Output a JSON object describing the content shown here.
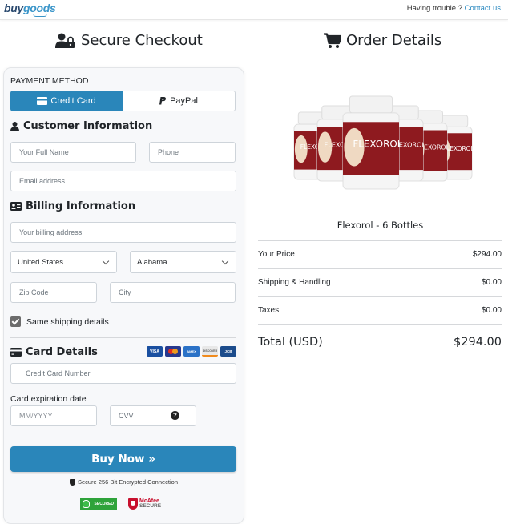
{
  "header": {
    "logo_part1": "buy",
    "logo_part2": "goods",
    "trouble_text": "Having trouble ? ",
    "contact_link": "Contact us"
  },
  "checkout": {
    "title": "Secure Checkout",
    "payment_method_label": "PAYMENT METHOD",
    "payment_methods": [
      {
        "label": "Credit Card",
        "selected": true
      },
      {
        "label": "PayPal",
        "selected": false
      }
    ],
    "customer_info": {
      "heading": "Customer Information",
      "full_name_placeholder": "Your Full Name",
      "phone_placeholder": "Phone",
      "email_placeholder": "Email address"
    },
    "billing_info": {
      "heading": "Billing Information",
      "address_placeholder": "Your billing address",
      "country_selected": "United States",
      "state_selected": "Alabama",
      "zip_placeholder": "Zip Code",
      "city_placeholder": "City",
      "same_shipping_label": "Same shipping details",
      "same_shipping_checked": true
    },
    "card_details": {
      "heading": "Card Details",
      "card_brands": [
        "VISA",
        "Mastercard",
        "AMEX",
        "DISCOVER",
        "JCB"
      ],
      "card_number_placeholder": "Credit Card Number",
      "expiration_label": "Card expiration date",
      "expiration_placeholder": "MM/YYYY",
      "cvv_placeholder": "CVV",
      "cvv_help": "?"
    },
    "buy_button": "Buy Now »",
    "secure_text": "Secure 256 Bit Encrypted Connection",
    "badges": {
      "secured": "SECURED",
      "mcafee_top": "McAfee",
      "mcafee_bottom": "SECURE"
    }
  },
  "order": {
    "title": "Order Details",
    "product_name": "Flexorol - 6 Bottles",
    "bottle_label": "FLEXOROL",
    "bottle_count": 6,
    "lines": [
      {
        "label": "Your Price",
        "value": "$294.00"
      },
      {
        "label": "Shipping & Handling",
        "value": "$0.00"
      },
      {
        "label": "Taxes",
        "value": "$0.00"
      }
    ],
    "total_label": "Total (USD)",
    "total_value": "$294.00"
  },
  "colors": {
    "accent": "#2a86ba",
    "link": "#2a89c0",
    "bottle_red": "#8e1a1f"
  }
}
